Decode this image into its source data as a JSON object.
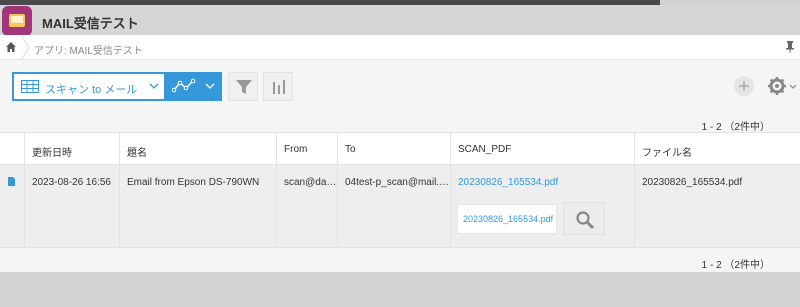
{
  "app": {
    "title": "MAIL受信テスト",
    "icon": "mail-app-icon"
  },
  "breadcrumb": {
    "text": "アプリ: MAIL受信テスト"
  },
  "toolbar": {
    "view_label": "スキャン to メール",
    "graph_icon": "graph-icon",
    "filter_icon": "filter-icon",
    "chart_icon": "bar-chart-icon"
  },
  "pagination": {
    "text": "1 - 2 （2件中）"
  },
  "table": {
    "headers": [
      "更新日時",
      "題名",
      "From",
      "To",
      "SCAN_PDF",
      "ファイル名"
    ],
    "rows": [
      {
        "updated": "2023-08-26 16:56",
        "subject": "Email from Epson DS-790WN",
        "from": "scan@da…",
        "to": "04test-p_scan@mail.…",
        "scan_pdf_link": "20230826_165534.pdf",
        "scan_pdf_file": "20230826_165534.pdf",
        "filename": "20230826_165534.pdf"
      }
    ]
  },
  "colors": {
    "accent": "#3498db",
    "app_icon": "#a3357a"
  }
}
